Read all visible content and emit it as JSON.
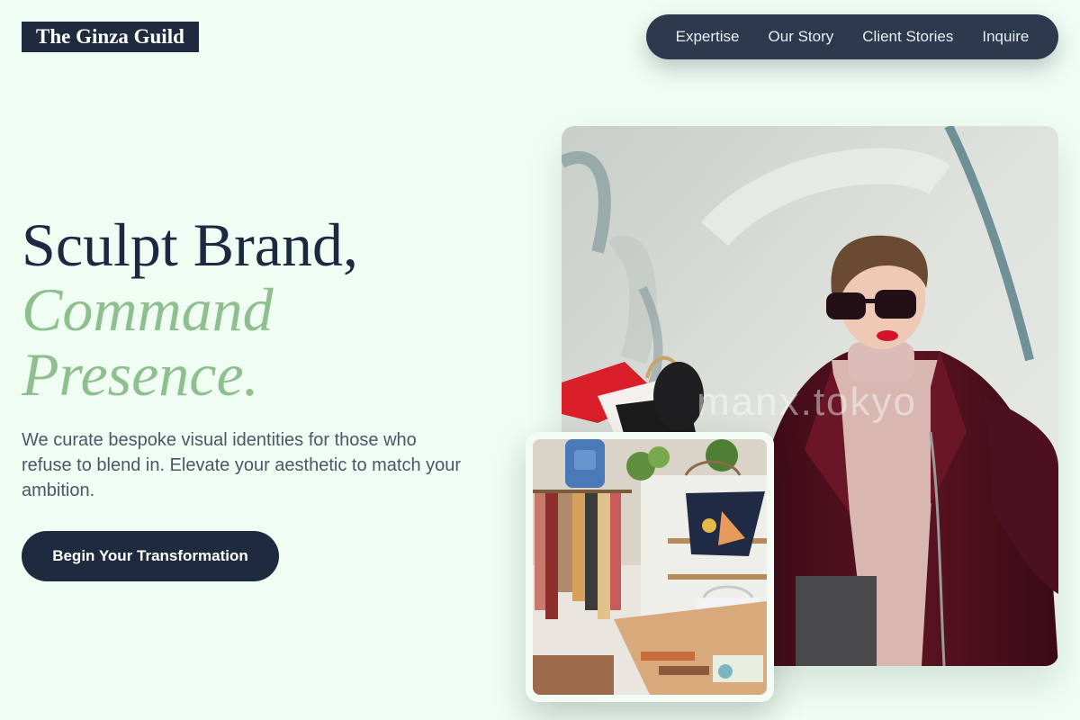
{
  "brand": {
    "logo_text": "The Ginza Guild"
  },
  "nav": {
    "items": [
      {
        "label": "Expertise"
      },
      {
        "label": "Our Story"
      },
      {
        "label": "Client Stories"
      },
      {
        "label": "Inquire"
      }
    ]
  },
  "hero": {
    "headline_line1": "Sculpt Brand,",
    "headline_line2": "Command",
    "headline_line3": "Presence.",
    "lead": "We curate bespoke visual identities for those who refuse to blend in. Elevate your aesthetic to match your ambition.",
    "cta_label": "Begin Your Transformation"
  },
  "images": {
    "main_watermark": "manx.tokyo"
  },
  "colors": {
    "background": "#effdf3",
    "navy": "#1e2a3d",
    "accent_green": "#8fbf8f",
    "body_text": "#4c5668"
  }
}
